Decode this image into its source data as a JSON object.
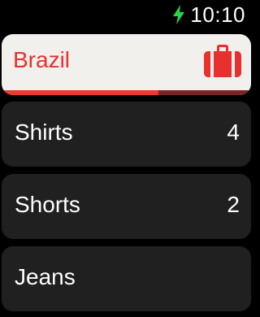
{
  "status": {
    "time": "10:10",
    "charging_icon": "charging-bolt-icon",
    "charging_color": "#27d84b"
  },
  "header": {
    "title": "Brazil",
    "icon": "suitcase-icon",
    "progress": 0.63,
    "accent": "#e8302f"
  },
  "items": [
    {
      "label": "Shirts",
      "count": "4"
    },
    {
      "label": "Shorts",
      "count": "2"
    },
    {
      "label": "Jeans",
      "count": ""
    }
  ]
}
